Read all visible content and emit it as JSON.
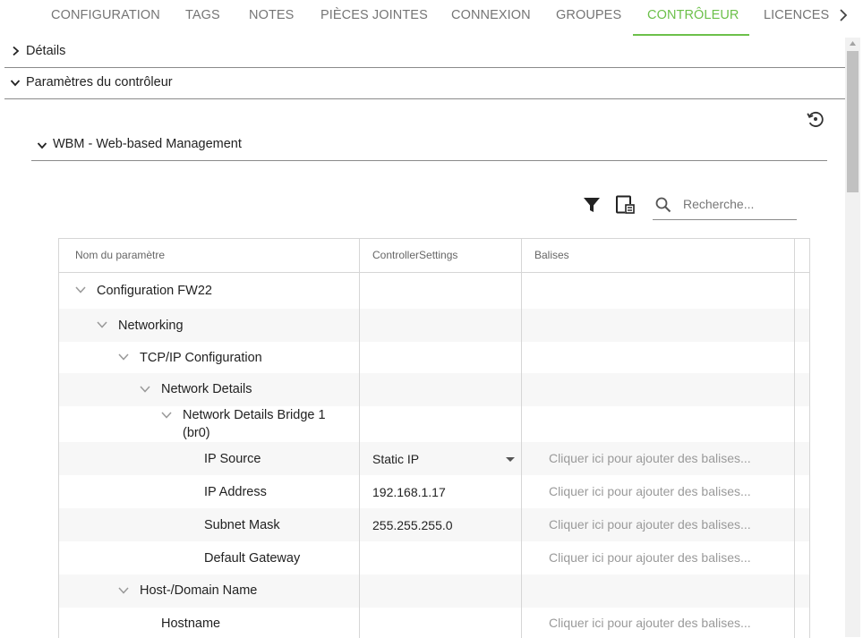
{
  "tabs": [
    {
      "label": "CONFIGURATION"
    },
    {
      "label": "TAGS"
    },
    {
      "label": "NOTES"
    },
    {
      "label": "PIÈCES JOINTES"
    },
    {
      "label": "CONNEXION"
    },
    {
      "label": "GROUPES"
    },
    {
      "label": "CONTRÔLEUR",
      "active": true
    },
    {
      "label": "LICENCES"
    }
  ],
  "sections": {
    "details": "Détails",
    "controller_params": "Paramètres du contrôleur",
    "wbm": "WBM - Web-based Management"
  },
  "search": {
    "placeholder": "Recherche..."
  },
  "table": {
    "columns": [
      "Nom du paramètre",
      "ControllerSettings",
      "Balises"
    ],
    "tag_placeholder": "Cliquer ici pour ajouter des balises...",
    "rows": [
      {
        "name": "Configuration FW22",
        "expanded": true
      },
      {
        "name": "Networking",
        "expanded": true
      },
      {
        "name": "TCP/IP Configuration",
        "expanded": true
      },
      {
        "name": "Network Details",
        "expanded": true
      },
      {
        "name": "Network Details Bridge 1 (br0)",
        "expanded": true
      },
      {
        "name": "IP Source",
        "value": "Static IP",
        "dropdown": true
      },
      {
        "name": "IP Address",
        "value": "192.168.1.17"
      },
      {
        "name": "Subnet Mask",
        "value": "255.255.255.0"
      },
      {
        "name": "Default Gateway",
        "value": ""
      },
      {
        "name": "Host-/Domain Name",
        "expanded": true
      },
      {
        "name": "Hostname",
        "value": ""
      }
    ]
  },
  "colors": {
    "accent": "#6cc04a",
    "text": "#222222",
    "muted": "#757575",
    "row_alt": "#f7f7f7"
  }
}
